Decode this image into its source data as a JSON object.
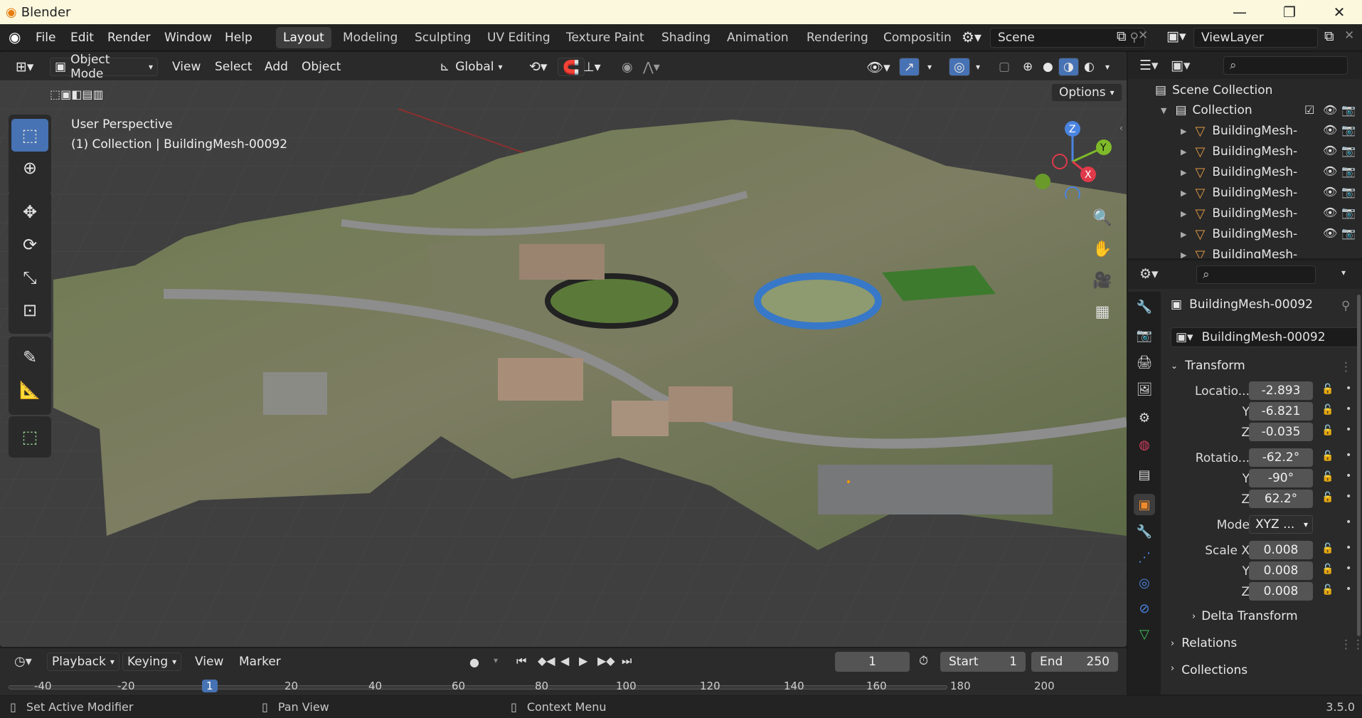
{
  "window": {
    "title": "Blender",
    "version": "3.5.0"
  },
  "menu": [
    "File",
    "Edit",
    "Render",
    "Window",
    "Help"
  ],
  "workspaces": [
    "Layout",
    "Modeling",
    "Sculpting",
    "UV Editing",
    "Texture Paint",
    "Shading",
    "Animation",
    "Rendering",
    "Compositin"
  ],
  "scene": {
    "name": "Scene",
    "viewlayer": "ViewLayer"
  },
  "viewport": {
    "mode": "Object Mode",
    "menus": [
      "View",
      "Select",
      "Add",
      "Object"
    ],
    "orientation": "Global",
    "options": "Options",
    "info_line1": "User Perspective",
    "info_line2": "(1) Collection | BuildingMesh-00092",
    "gizmo_axes": [
      "Z",
      "Y",
      "X"
    ]
  },
  "outliner": {
    "scene_collection": "Scene Collection",
    "collection": "Collection",
    "items": [
      "BuildingMesh-",
      "BuildingMesh-",
      "BuildingMesh-",
      "BuildingMesh-",
      "BuildingMesh-",
      "BuildingMesh-",
      "BuildingMesh-"
    ]
  },
  "properties": {
    "object_name": "BuildingMesh-00092",
    "data_name": "BuildingMesh-00092",
    "transform_label": "Transform",
    "location_label": "Locatio...",
    "location": [
      "-2.893",
      "-6.821",
      "-0.035"
    ],
    "rotation_label": "Rotatio...",
    "rotation": [
      "-62.2°",
      "-90°",
      "62.2°"
    ],
    "mode_label": "Mode",
    "mode_value": "XYZ ...",
    "scale_label": "Scale X",
    "scale": [
      "0.008",
      "0.008",
      "0.008"
    ],
    "axis_y": "Y",
    "axis_z": "Z",
    "delta_transform": "Delta Transform",
    "relations": "Relations",
    "collections": "Collections"
  },
  "timeline": {
    "menus": [
      "Playback",
      "Keying",
      "View",
      "Marker"
    ],
    "current_frame": "1",
    "start_label": "Start",
    "start": "1",
    "end_label": "End",
    "end": "250",
    "ruler": [
      "-40",
      "-20",
      "1",
      "20",
      "40",
      "60",
      "80",
      "100",
      "120",
      "140",
      "160",
      "180",
      "200"
    ]
  },
  "status": {
    "item1": "Set Active Modifier",
    "item2": "Pan View",
    "item3": "Context Menu"
  }
}
